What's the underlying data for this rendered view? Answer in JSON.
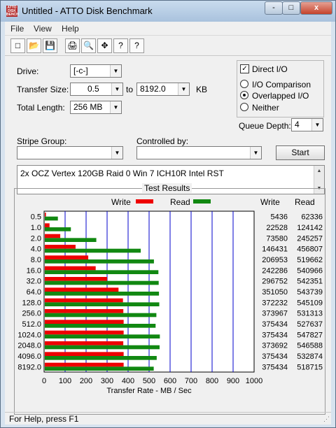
{
  "window": {
    "title": "Untitled - ATTO Disk Benchmark",
    "app_icon": "atto-logo-icon",
    "min": "-",
    "max": "□",
    "close": "x"
  },
  "menu": [
    "File",
    "View",
    "Help"
  ],
  "toolbar": {
    "icons": [
      "new-document-icon",
      "open-folder-icon",
      "save-icon",
      "print-icon",
      "print-preview-icon",
      "move-icon",
      "help-icon",
      "context-help-icon"
    ],
    "glyphs": [
      "□",
      "📂",
      "💾",
      "🖨",
      "🔍",
      "✥",
      "?",
      "?"
    ]
  },
  "form": {
    "drive_label": "Drive:",
    "drive_value": "[-c-]",
    "transfer_size_label": "Transfer Size:",
    "transfer_min": "0.5",
    "to_label": "to",
    "transfer_max": "8192.0",
    "kb_label": "KB",
    "total_length_label": "Total Length:",
    "total_length_value": "256 MB",
    "direct_io_label": "Direct I/O",
    "direct_io_checked": true,
    "io_options": [
      {
        "label": "I/O Comparison",
        "selected": false
      },
      {
        "label": "Overlapped I/O",
        "selected": true
      },
      {
        "label": "Neither",
        "selected": false
      }
    ],
    "queue_depth_label": "Queue Depth:",
    "queue_depth_value": "4",
    "stripe_group_label": "Stripe Group:",
    "stripe_group_value": "",
    "controlled_by_label": "Controlled by:",
    "controlled_by_value": "",
    "start_label": "Start",
    "description": "2x OCZ Vertex 120GB Raid 0 Win 7 ICH10R Intel RST"
  },
  "results": {
    "title": "Test Results",
    "legend_write": "Write",
    "legend_read": "Read",
    "col_write": "Write",
    "col_read": "Read",
    "xlabel": "Transfer Rate - MB / Sec",
    "write_color": "#ee0000",
    "read_color": "#118811"
  },
  "chart_data": {
    "type": "bar",
    "orientation": "horizontal",
    "categories": [
      "0.5",
      "1.0",
      "2.0",
      "4.0",
      "8.0",
      "16.0",
      "32.0",
      "64.0",
      "128.0",
      "256.0",
      "512.0",
      "1024.0",
      "2048.0",
      "4096.0",
      "8192.0"
    ],
    "series": [
      {
        "name": "Write",
        "values": [
          5436,
          22528,
          73580,
          146431,
          206953,
          242286,
          296752,
          351050,
          372232,
          373967,
          375434,
          375434,
          373692,
          375434,
          375434
        ]
      },
      {
        "name": "Read",
        "values": [
          62336,
          124142,
          245257,
          456807,
          519662,
          540966,
          542351,
          543739,
          545109,
          531313,
          527637,
          547827,
          546588,
          532874,
          518715
        ]
      }
    ],
    "xlabel": "Transfer Rate - MB / Sec",
    "xlim": [
      0,
      1000
    ],
    "xticks": [
      0,
      100,
      200,
      300,
      400,
      500,
      600,
      700,
      800,
      900,
      1000
    ],
    "grid": true
  },
  "status": "For Help, press F1"
}
